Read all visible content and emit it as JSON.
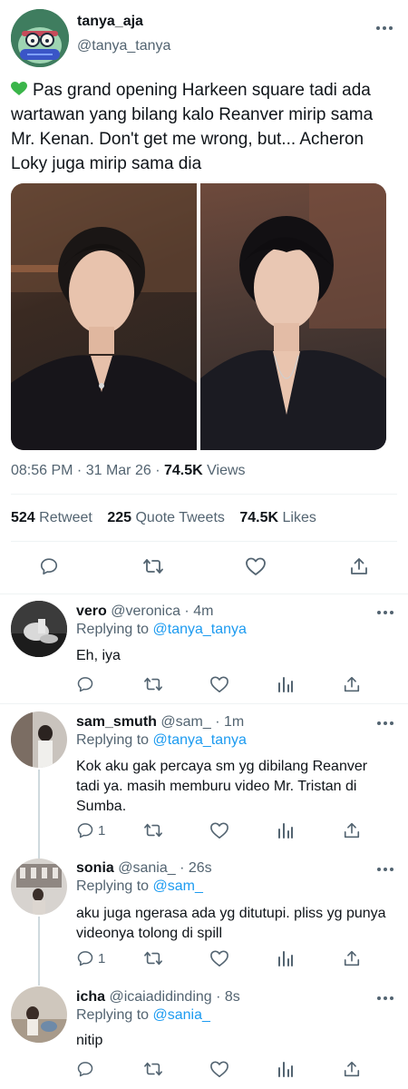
{
  "main_tweet": {
    "display_name": "tanya_aja",
    "handle": "@tanya_tanya",
    "heart_emoji": "💚",
    "text": "Pas grand opening Harkeen square tadi ada wartawan yang bilang kalo Reanver mirip sama Mr. Kenan. Don't get me wrong, but... Acheron Loky juga mirip sama dia",
    "time": "08:56 PM · 31 Mar 26 ·",
    "views_count": "74.5K",
    "views_label": "Views",
    "retweets_count": "524",
    "retweets_label": "Retweet",
    "quotes_count": "225",
    "quotes_label": "Quote Tweets",
    "likes_count": "74.5K",
    "likes_label": "Likes"
  },
  "replies": [
    {
      "display_name": "vero",
      "handle": "@veronica",
      "time": "· 4m",
      "replying_label": "Replying to",
      "replying_to": "@tanya_tanya",
      "text": "Eh, iya",
      "reply_count": ""
    },
    {
      "display_name": "sam_smuth",
      "handle": "@sam_",
      "time": "· 1m",
      "replying_label": "Replying to",
      "replying_to": "@tanya_tanya",
      "text": "Kok aku gak percaya sm yg dibilang Reanver tadi ya. masih memburu video Mr. Tristan di Sumba.",
      "reply_count": "1"
    },
    {
      "display_name": "sonia",
      "handle": "@sania_",
      "time": "· 26s",
      "replying_label": "Replying to",
      "replying_to": "@sam_",
      "text": "aku juga ngerasa ada yg ditutupi. pliss yg punya videonya tolong di spill",
      "reply_count": "1"
    },
    {
      "display_name": "icha",
      "handle": "@icaiadidinding",
      "time": "· 8s",
      "replying_label": "Replying to",
      "replying_to": "@sania_",
      "text": "nitip",
      "reply_count": ""
    }
  ],
  "colors": {
    "accent": "#1d9bf0",
    "secondary_text": "#536471",
    "divider": "#eff3f4",
    "heart_emoji": "#3ab54a"
  }
}
